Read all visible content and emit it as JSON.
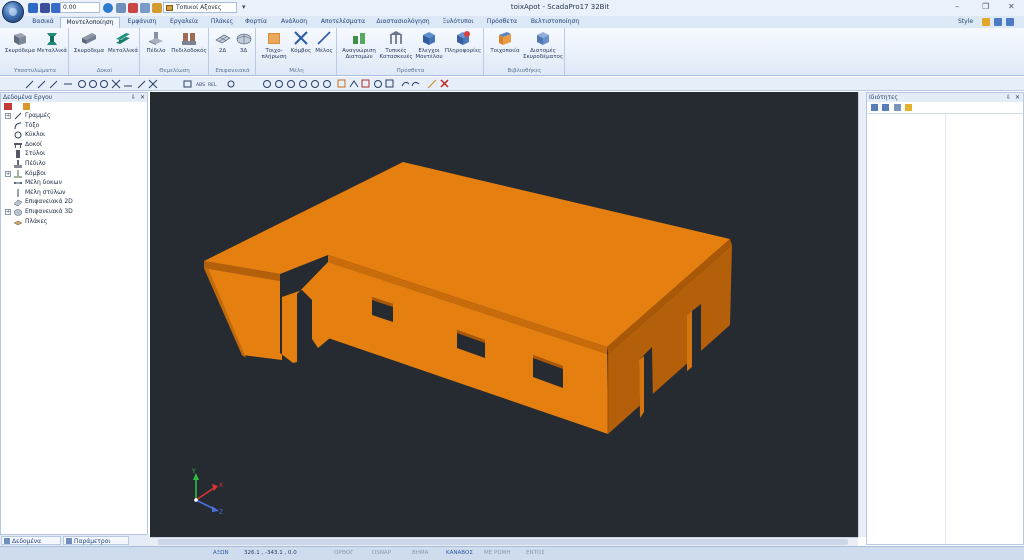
{
  "window": {
    "title": "toixApot - ScadaPro17 32Bit",
    "controls": [
      "–",
      "❐",
      "✕"
    ]
  },
  "quick_access": {
    "units_value": "0.00",
    "axes_selector": "Τοπικοί Αξονες"
  },
  "ribbon_tabs": [
    {
      "label": "Βασικά",
      "active": false
    },
    {
      "label": "Μοντελοποίηση",
      "active": true
    },
    {
      "label": "Εμφάνιση",
      "active": false
    },
    {
      "label": "Εργαλεία",
      "active": false
    },
    {
      "label": "Πλάκες",
      "active": false
    },
    {
      "label": "Φορτία",
      "active": false
    },
    {
      "label": "Ανάλυση",
      "active": false
    },
    {
      "label": "Αποτελέσματα",
      "active": false
    },
    {
      "label": "Διαστασιολόγηση",
      "active": false
    },
    {
      "label": "Ξυλότυποι",
      "active": false
    },
    {
      "label": "Πρόσθετα",
      "active": false
    },
    {
      "label": "Βελτιστοποίηση",
      "active": false
    }
  ],
  "style_label": "Style",
  "ribbon_groups": [
    {
      "label": "Υποστυλώματα",
      "buttons": [
        "Σκυρόδεμα",
        "Μεταλλικά"
      ]
    },
    {
      "label": "Δοκοί",
      "buttons": [
        "Σκυρόδεμα",
        "Μεταλλικά"
      ]
    },
    {
      "label": "Θεμελίωση",
      "buttons": [
        "Πέδιλο",
        "Πεδιλοδοκός"
      ]
    },
    {
      "label": "Επιφανειακά",
      "buttons": [
        "2Δ",
        "3Δ"
      ]
    },
    {
      "label": "Μέλη",
      "buttons": [
        "Τοιχο-πλήρωση",
        "Κόμβος",
        "Μέλος"
      ]
    },
    {
      "label": "Πρόσθετα",
      "buttons": [
        "Αναγνώριση Διατομών",
        "Τυπικές Κατασκευές",
        "Ελεγχοι Μοντέλου",
        "Πληροφορίες"
      ]
    },
    {
      "label": "Βιβλιοθήκες",
      "buttons": [
        "Τοιχοποιία",
        "Διατομές Σκυροδέματος"
      ]
    }
  ],
  "project_panel": {
    "title": "Δεδομένα Εργου",
    "tree": [
      {
        "label": "Γραμμές",
        "expandable": true,
        "icon": "line-icon"
      },
      {
        "label": "Τόξο",
        "expandable": false,
        "icon": "arc-icon"
      },
      {
        "label": "Κύκλοι",
        "expandable": false,
        "icon": "circle-icon"
      },
      {
        "label": "Δοκοί",
        "expandable": false,
        "icon": "beam-icon"
      },
      {
        "label": "Στύλοι",
        "expandable": false,
        "icon": "column-icon"
      },
      {
        "label": "Πέδιλο",
        "expandable": false,
        "icon": "footing-icon"
      },
      {
        "label": "Κόμβοι",
        "expandable": true,
        "icon": "node-icon"
      },
      {
        "label": "Μέλη δοκων",
        "expandable": false,
        "icon": "beam-member-icon"
      },
      {
        "label": "Μέλη στύλων",
        "expandable": false,
        "icon": "column-member-icon"
      },
      {
        "label": "Επιφανειακά 2D",
        "expandable": false,
        "icon": "surface-2d-icon"
      },
      {
        "label": "Επιφανειακά 3D",
        "expandable": true,
        "icon": "surface-3d-icon"
      },
      {
        "label": "Πλάκες",
        "expandable": false,
        "icon": "slab-icon"
      }
    ]
  },
  "properties_panel": {
    "title": "Ιδιότητες"
  },
  "bottom_tabs": [
    {
      "label": "Δεδομένα Εργου"
    },
    {
      "label": "Παράμετροι Εργου"
    }
  ],
  "viewport": {
    "model_color": "#e57f10",
    "model_dark": "#b4600a",
    "model_light": "#f29124",
    "background": "#262a31",
    "axis_labels": {
      "x": "X",
      "y": "Y",
      "z": "Z"
    }
  },
  "statusbar": {
    "axis_mode": "ΑΞΩΝ",
    "coordinates": "326.1 , -343.1 , 0.0",
    "toggles": [
      {
        "label": "ΟΡΘΟΓ",
        "on": false
      },
      {
        "label": "OSNAP",
        "on": false
      },
      {
        "label": "ΒΗΜΑ",
        "on": false
      },
      {
        "label": "ΚΑΝΑΒΟΣ",
        "on": true
      },
      {
        "label": "ΜΕ ΡΟΜΗ",
        "on": false
      },
      {
        "label": "ΕΝΤΟΣ",
        "on": false
      }
    ]
  }
}
